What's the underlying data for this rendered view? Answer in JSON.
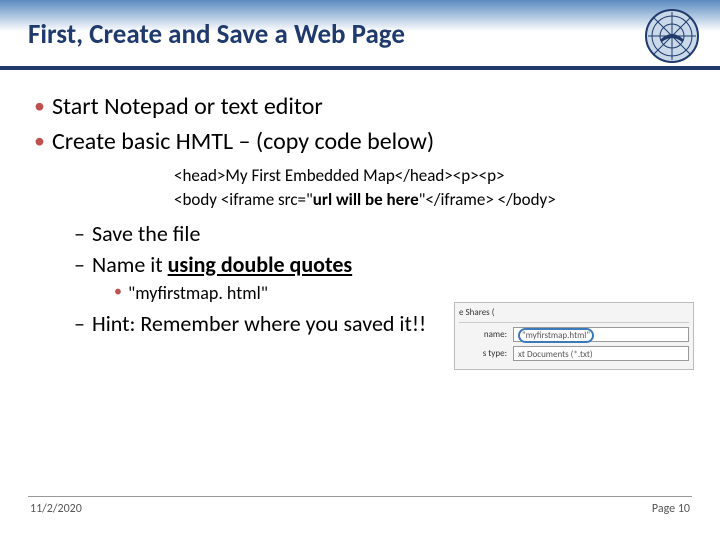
{
  "title": "First, Create and Save a Web Page",
  "bullets": {
    "top1": "Start Notepad or text editor",
    "top2": "Create basic HMTL – (copy code below)"
  },
  "code": {
    "line1": "<head>My First Embedded Map</head><p><p>",
    "line2a": "<body <iframe src=\"",
    "line2b": "url will be here",
    "line2c": "\"</iframe> </body>"
  },
  "sub": {
    "save": "Save the file",
    "name_prefix": "Name it ",
    "name_bold": "using double quotes",
    "example": "\"myfirstmap. html\"",
    "hint": "Hint: Remember where you saved it!!"
  },
  "screenshot": {
    "top": "e Shares (",
    "name_label": "name:",
    "name_value": "\"myfirstmap.html\"",
    "type_label": "s type:",
    "type_value": "xt Documents (*.txt)"
  },
  "footer": {
    "date": "11/2/2020",
    "page": "Page 10"
  }
}
